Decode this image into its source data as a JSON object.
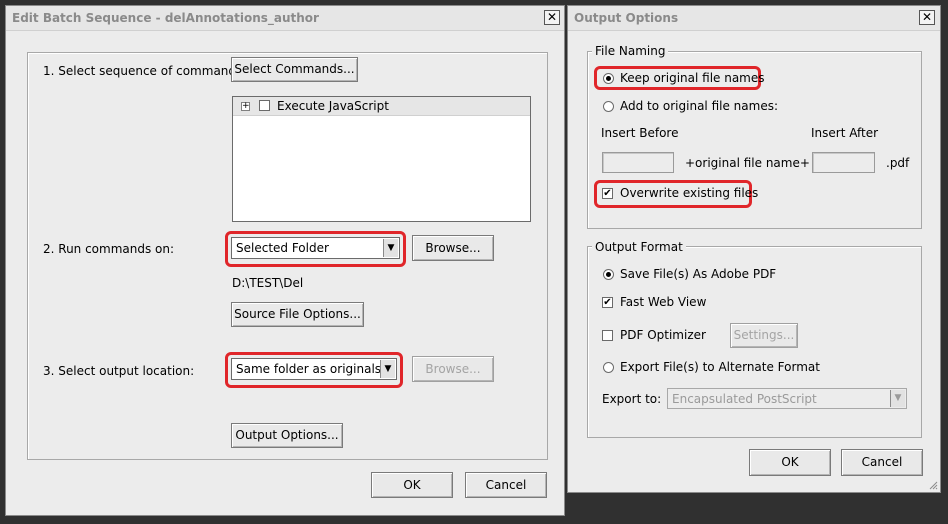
{
  "batch_dialog": {
    "title": "Edit Batch Sequence - delAnnotations_author",
    "close_glyph": "✕",
    "step1_label": "1. Select sequence of commands:",
    "select_commands_button": "Select Commands...",
    "commands": [
      {
        "label": "Execute JavaScript",
        "checked": false,
        "expander": "+"
      }
    ],
    "step2_label": "2. Run commands on:",
    "run_on_value": "Selected Folder",
    "browse_button": "Browse...",
    "selected_path": "D:\\TEST\\Del",
    "source_file_options_button": "Source File Options...",
    "step3_label": "3. Select output location:",
    "output_location_value": "Same folder as originals",
    "browse_disabled_button": "Browse...",
    "output_options_button": "Output Options...",
    "ok_button": "OK",
    "cancel_button": "Cancel"
  },
  "output_dialog": {
    "title": "Output Options",
    "close_glyph": "✕",
    "file_naming": {
      "legend": "File Naming",
      "keep_original_label": "Keep original file names",
      "add_to_original_label": "Add to original file names:",
      "insert_before_label": "Insert Before",
      "insert_after_label": "Insert After",
      "insert_before_value": "",
      "insert_after_value": "",
      "middle_text": "+original file name+",
      "suffix_text": ".pdf",
      "overwrite_label": "Overwrite existing files"
    },
    "output_format": {
      "legend": "Output Format",
      "save_pdf_label": "Save File(s) As Adobe PDF",
      "fast_web_view_label": "Fast Web View",
      "pdf_optimizer_label": "PDF Optimizer",
      "settings_button": "Settings...",
      "export_alternate_label": "Export File(s) to Alternate Format",
      "export_to_label": "Export to:",
      "export_to_value": "Encapsulated PostScript"
    },
    "ok_button": "OK",
    "cancel_button": "Cancel"
  },
  "state": {
    "keep_original_selected": true,
    "add_to_original_selected": false,
    "overwrite_checked": true,
    "save_pdf_selected": true,
    "fast_web_view_checked": true,
    "pdf_optimizer_checked": false,
    "export_alternate_selected": false
  },
  "colors": {
    "highlight": "#e0262a",
    "dialog_bg": "#ececec",
    "desktop_bg": "#303030",
    "disabled_text": "#a4a4a4"
  },
  "icons": {
    "dropdown_arrow": "▼",
    "check_mark": "✔",
    "expander": "+"
  }
}
